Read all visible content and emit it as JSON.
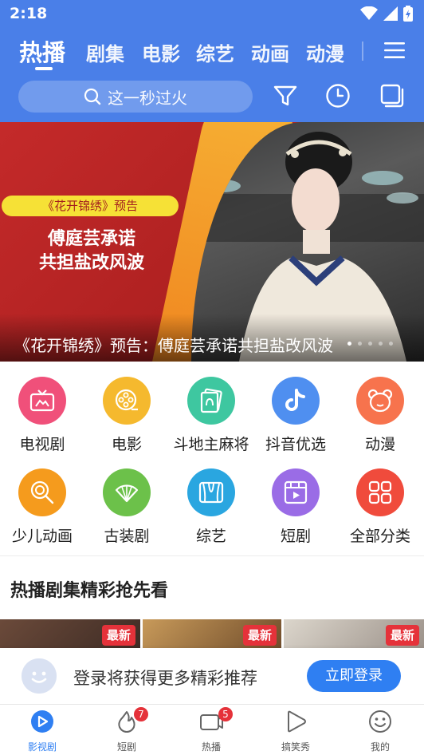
{
  "status_bar": {
    "time": "2:18"
  },
  "header": {
    "tabs": [
      {
        "label": "热播",
        "active": true
      },
      {
        "label": "剧集"
      },
      {
        "label": "电影"
      },
      {
        "label": "综艺"
      },
      {
        "label": "动画"
      },
      {
        "label": "动漫"
      }
    ],
    "search_placeholder": "这一秒过火",
    "icons": [
      "filter-icon",
      "history-icon",
      "square-icon",
      "menu-icon"
    ],
    "bg_color": "#4a7fe8"
  },
  "banner": {
    "tag": "《花开锦绣》预告",
    "headline_line1": "傅庭芸承诺",
    "headline_line2": "共担盐改风波",
    "caption": "《花开锦绣》预告：傅庭芸承诺共担盐改风波"
  },
  "categories": [
    {
      "label": "电视剧",
      "color": "#f0507a",
      "icon": "tv-icon"
    },
    {
      "label": "电影",
      "color": "#f5b92e",
      "icon": "film-reel-icon"
    },
    {
      "label": "斗地主麻将",
      "color": "#3ec7a0",
      "icon": "cards-icon"
    },
    {
      "label": "抖音优选",
      "color": "#4f8ff0",
      "icon": "tiktok-icon"
    },
    {
      "label": "动漫",
      "color": "#f7734d",
      "icon": "bear-icon"
    },
    {
      "label": "少儿动画",
      "color": "#f59b1d",
      "icon": "lollipop-icon"
    },
    {
      "label": "古装剧",
      "color": "#6cc14a",
      "icon": "fan-icon"
    },
    {
      "label": "综艺",
      "color": "#2aa6e0",
      "icon": "curtain-icon"
    },
    {
      "label": "短剧",
      "color": "#9a6ce6",
      "icon": "play-window-icon"
    },
    {
      "label": "全部分类",
      "color": "#f04b3c",
      "icon": "grid-icon"
    }
  ],
  "section": {
    "title": "热播剧集精彩抢先看"
  },
  "thumbnails": [
    {
      "badge": "最新"
    },
    {
      "badge": "最新"
    },
    {
      "badge": "最新"
    }
  ],
  "login_prompt": {
    "text": "登录将获得更多精彩推荐",
    "button": "立即登录"
  },
  "bottom_nav": [
    {
      "label": "影视剧",
      "active": true,
      "icon": "play-circle-icon"
    },
    {
      "label": "短剧",
      "badge": "7",
      "icon": "flame-icon"
    },
    {
      "label": "热播",
      "badge": "5",
      "icon": "camera-icon"
    },
    {
      "label": "搞笑秀",
      "icon": "play-outline-icon"
    },
    {
      "label": "我的",
      "icon": "smiley-icon"
    }
  ]
}
